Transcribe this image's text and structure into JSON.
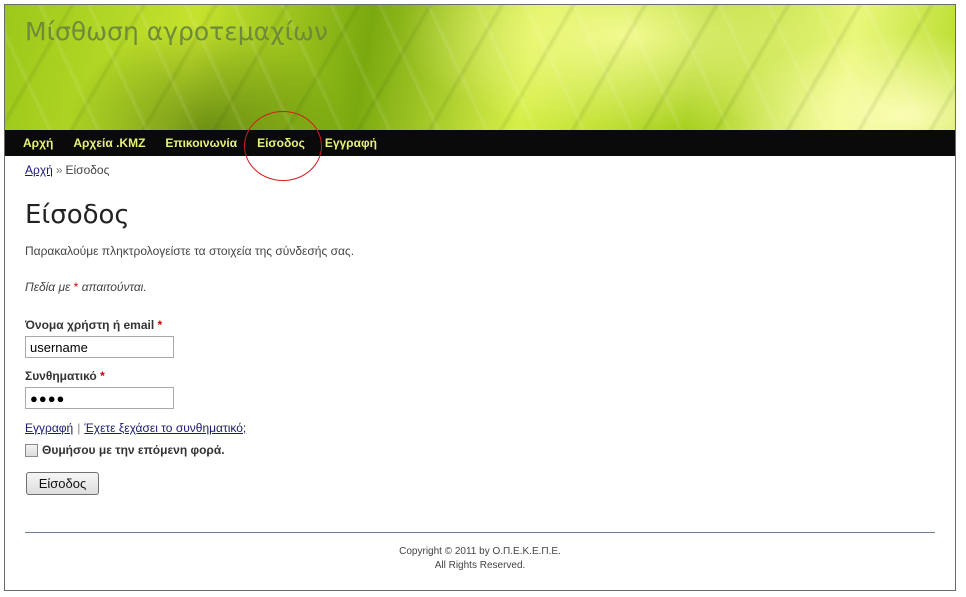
{
  "site": {
    "title": "Μίσθωση αγροτεμαχίων"
  },
  "nav": {
    "items": [
      {
        "label": "Αρχή"
      },
      {
        "label": "Αρχεία .KMZ"
      },
      {
        "label": "Επικοινωνία"
      },
      {
        "label": "Είσοδος"
      },
      {
        "label": "Εγγραφή"
      }
    ],
    "highlighted_item": "Είσοδος"
  },
  "breadcrumb": {
    "home": "Αρχή",
    "separator": "»",
    "current": "Είσοδος"
  },
  "page": {
    "heading": "Είσοδος",
    "intro": "Παρακαλούμε πληκτρολογείστε τα στοιχεία της σύνδεσής σας.",
    "required_note_prefix": "Πεδία με",
    "required_star": "*",
    "required_note_suffix": "απαιτούνται."
  },
  "form": {
    "username_label": "Όνομα χρήστη ή email",
    "username_value": "username",
    "password_label": "Συνθηματικό",
    "password_value": "●●●●",
    "register_link": "Εγγραφή",
    "link_separator": "|",
    "forgot_link": "Έχετε ξεχάσει το συνθηματικό;",
    "remember_label": "Θυμήσου με την επόμενη φορά.",
    "remember_checked": false,
    "submit_label": "Είσοδος"
  },
  "footer": {
    "copyright": "Copyright © 2011 by Ο.Π.Ε.Κ.Ε.Π.Ε.",
    "rights": "All Rights Reserved."
  },
  "colors": {
    "nav_background": "#0a0a0a",
    "nav_text": "#e6f27a",
    "annotation": "#cc1f1f",
    "required": "#cc0000"
  }
}
